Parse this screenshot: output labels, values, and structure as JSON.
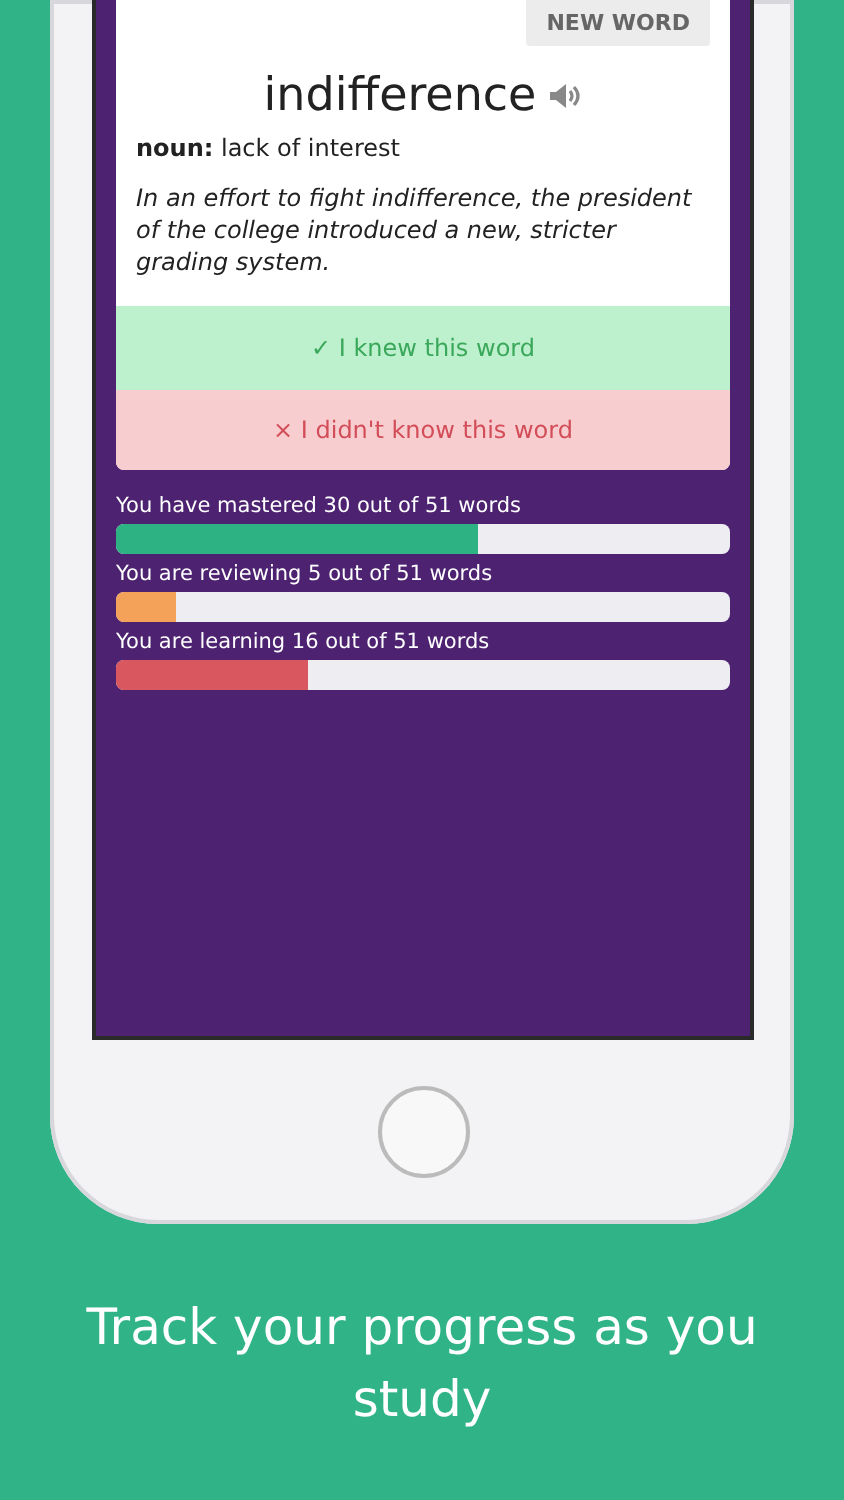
{
  "card": {
    "new_word_button": "NEW WORD",
    "word": "indifference",
    "definition": "**noun:** lack of interest",
    "example": "In an effort to fight indifference, the president of the college introduced a new, stricter grading system.",
    "knew_button": "✓ I knew this word",
    "didnt_know_button": "× I didn't know this word"
  },
  "progress": [
    {
      "label": "You have mastered 30 out of 51 words",
      "level": 0.588,
      "color": "#2db383"
    },
    {
      "label": "You are reviewing 5 out of 51 words",
      "level": 0.098,
      "color": "#f4a259"
    },
    {
      "label": "You are learning 16 out of 51 words",
      "level": 0.314,
      "color": "#d9575e"
    }
  ],
  "caption": "Track your progress as you study"
}
